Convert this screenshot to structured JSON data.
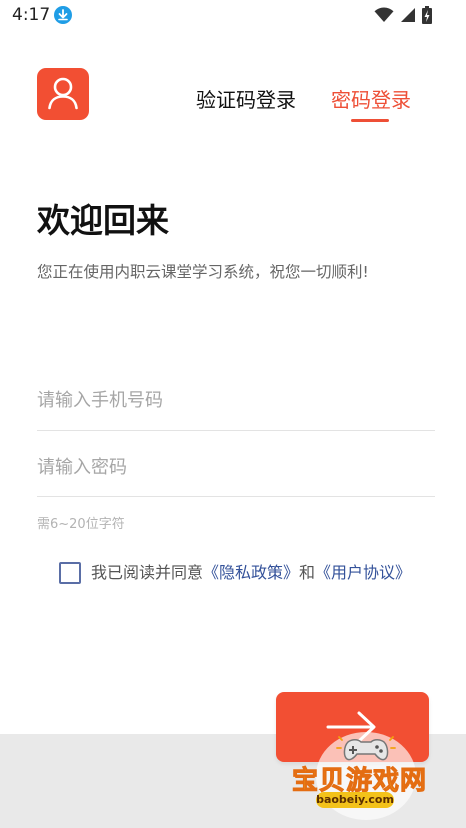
{
  "status_bar": {
    "time": "4:17",
    "icons": [
      "download-icon",
      "wifi-icon",
      "signal-icon",
      "battery-charging-icon"
    ]
  },
  "header": {
    "logo_icon": "user-icon",
    "tabs": [
      {
        "label": "验证码登录",
        "active": false
      },
      {
        "label": "密码登录",
        "active": true
      }
    ]
  },
  "welcome": {
    "title": "欢迎回来",
    "subtitle": "您正在使用内职云课堂学习系统，祝您一切顺利!"
  },
  "form": {
    "phone_placeholder": "请输入手机号码",
    "phone_value": "",
    "password_placeholder": "请输入密码",
    "password_value": "",
    "password_hint": "需6~20位字符",
    "agreement": {
      "checked": false,
      "prefix": "我已阅读并同意",
      "privacy_link": "《隐私政策》",
      "conjunction": "和",
      "user_link": "《用户协议》"
    },
    "submit_icon": "arrow-right-icon"
  },
  "watermark": {
    "text": "宝贝游戏网",
    "domain": "baobeiy.com"
  },
  "colors": {
    "accent": "#ee4f36",
    "link": "#34529a",
    "placeholder": "#a6a6a6",
    "watermark_yellow": "#f8d21c"
  }
}
